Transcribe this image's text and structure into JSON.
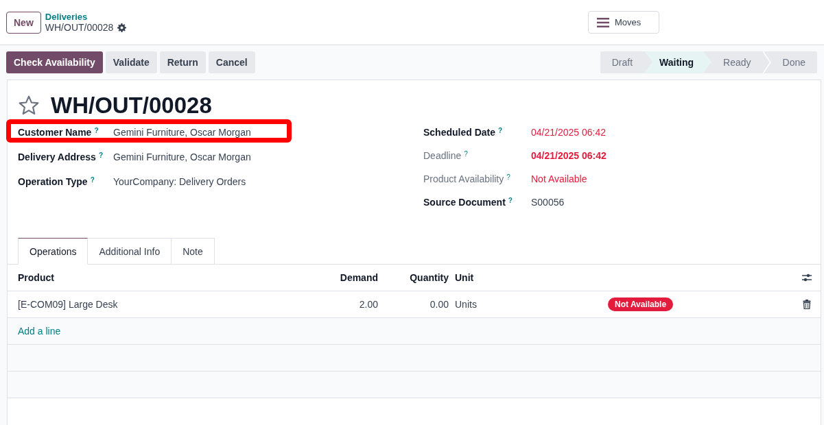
{
  "top_bar": {
    "new_button": "New",
    "breadcrumb": {
      "parent": "Deliveries",
      "current": "WH/OUT/00028"
    },
    "moves_button": "Moves"
  },
  "action_buttons": [
    {
      "label": "Check Availability",
      "kind": "primary"
    },
    {
      "label": "Validate",
      "kind": "secondary"
    },
    {
      "label": "Return",
      "kind": "secondary"
    },
    {
      "label": "Cancel",
      "kind": "secondary"
    }
  ],
  "status_stages": [
    {
      "label": "Draft",
      "selected": false
    },
    {
      "label": "Waiting",
      "selected": true
    },
    {
      "label": "Ready",
      "selected": false
    },
    {
      "label": "Done",
      "selected": false
    }
  ],
  "record": {
    "starred": false,
    "title": "WH/OUT/00028"
  },
  "fields_left": [
    {
      "label": "Customer Name",
      "hint": "?",
      "value": "Gemini Furniture, Oscar Morgan",
      "label_muted": false,
      "value_alert": false,
      "value_bold": false,
      "highlighted": true
    },
    {
      "label": "Delivery Address",
      "hint": "?",
      "value": "Gemini Furniture, Oscar Morgan",
      "label_muted": false,
      "value_alert": false,
      "value_bold": false,
      "highlighted": false
    },
    {
      "label": "Operation Type",
      "hint": "?",
      "value": "YourCompany: Delivery Orders",
      "label_muted": false,
      "value_alert": false,
      "value_bold": false,
      "highlighted": false
    }
  ],
  "fields_right": [
    {
      "label": "Scheduled Date",
      "hint": "?",
      "value": "04/21/2025 06:42",
      "label_muted": false,
      "value_alert": true,
      "value_bold": false,
      "highlighted": false
    },
    {
      "label": "Deadline",
      "hint": "?",
      "value": "04/21/2025 06:42",
      "label_muted": true,
      "value_alert": true,
      "value_bold": true,
      "highlighted": false
    },
    {
      "label": "Product Availability",
      "hint": "?",
      "value": "Not Available",
      "label_muted": true,
      "value_alert": true,
      "value_bold": false,
      "highlighted": false
    },
    {
      "label": "Source Document",
      "hint": "?",
      "value": "S00056",
      "label_muted": false,
      "value_alert": false,
      "value_bold": false,
      "highlighted": false
    }
  ],
  "tabs": [
    {
      "label": "Operations",
      "selected": true
    },
    {
      "label": "Additional Info",
      "selected": false
    },
    {
      "label": "Note",
      "selected": false
    }
  ],
  "table": {
    "columns": [
      "Product",
      "Demand",
      "Quantity",
      "Unit"
    ],
    "rows": [
      {
        "product": "[E-COM09] Large Desk",
        "demand": "2.00",
        "quantity": "0.00",
        "unit": "Units",
        "status": "Not Available"
      }
    ],
    "add_line": "Add a line"
  }
}
